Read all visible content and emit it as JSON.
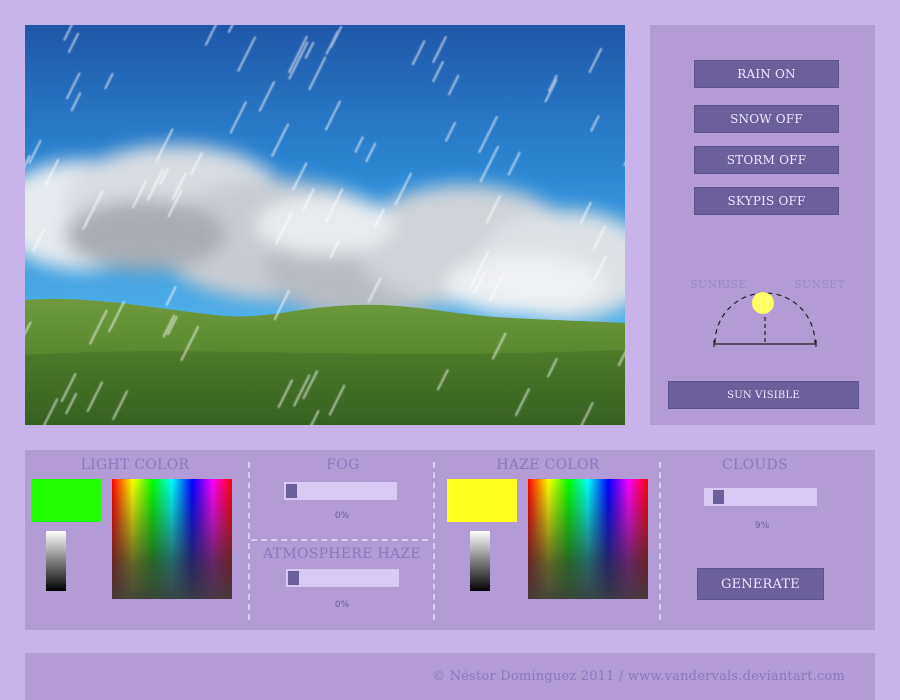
{
  "colors": {
    "page_bg": "#c8b4ea",
    "panel_bg": "#b39bd6",
    "button_bg": "#6b5f9c",
    "slider_track": "#d8c8f4",
    "light_color": "#22ff00",
    "haze_color": "#ffff22",
    "sun": "#ffff66"
  },
  "scene": {
    "description_icon": "landscape-rain-scene"
  },
  "controls": {
    "rain_label": "RAIN ON",
    "snow_label": "SNOW OFF",
    "storm_label": "STORM OFF",
    "skypis_label": "SKYPIS OFF",
    "sunrise_label": "SUNRISE",
    "sunset_label": "SUNSET",
    "sun_visible_label": "SUN VISIBLE"
  },
  "panels": {
    "light_color": {
      "title": "LIGHT COLOR"
    },
    "fog": {
      "title": "FOG",
      "value": 0,
      "value_label": "0%"
    },
    "atmosphere_haze": {
      "title": "ATMOSPHERE HAZE",
      "value": 0,
      "value_label": "0%"
    },
    "haze_color": {
      "title": "HAZE COLOR"
    },
    "clouds": {
      "title": "CLOUDS",
      "value": 9,
      "value_label": "9%"
    },
    "generate_label": "GENERATE"
  },
  "footer": {
    "credit": "© Néstor Domínguez 2011  /  www.vandervals.deviantart.com"
  }
}
